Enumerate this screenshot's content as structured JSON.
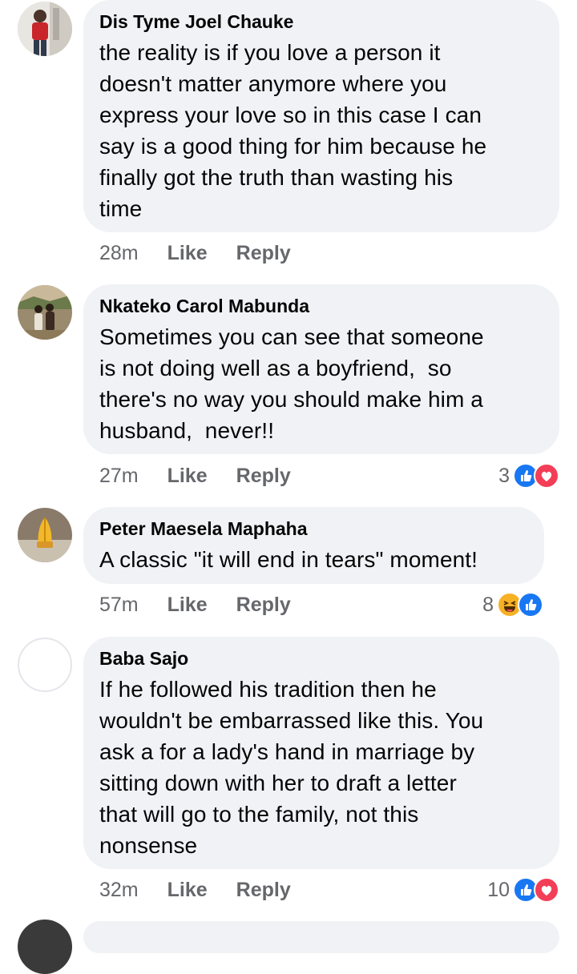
{
  "comments": [
    {
      "author": "Dis Tyme Joel Chauke",
      "text": "the reality is if you love a person it\ndoesn't matter anymore where you\nexpress your love so in this case I can\nsay is a good thing for him because he\nfinally got the truth than wasting his\ntime",
      "time": "28m",
      "like": "Like",
      "reply": "Reply",
      "reaction_count": "",
      "reactions": [],
      "avatar": "photo"
    },
    {
      "author": "Nkateko Carol Mabunda",
      "text": "Sometimes you can see that someone\nis not doing well as a boyfriend,  so\nthere's no way you should make him a\nhusband,  never!!",
      "time": "27m",
      "like": "Like",
      "reply": "Reply",
      "reaction_count": "3",
      "reactions": [
        "like-icon",
        "love-icon"
      ],
      "avatar": "photo"
    },
    {
      "author": "Peter Maesela Maphaha",
      "text": "A classic \"it will end in tears\" moment!",
      "time": "57m",
      "like": "Like",
      "reply": "Reply",
      "reaction_count": "8",
      "reactions": [
        "haha-icon",
        "like-icon"
      ],
      "avatar": "praying-hands"
    },
    {
      "author": "Baba Sajo",
      "text": "If he followed his tradition then he\nwouldn't be embarrassed like this. You\nask a for a lady's hand in marriage by\nsitting down with her to draft a letter\nthat will go to the family, not this\nnonsense",
      "time": "32m",
      "like": "Like",
      "reply": "Reply",
      "reaction_count": "10",
      "reactions": [
        "like-icon",
        "love-icon"
      ],
      "avatar": "blank"
    }
  ],
  "colors": {
    "bubble": "#f0f2f5",
    "meta": "#65676b",
    "like": "#1877f2",
    "love": "#f33e58",
    "haha": "#f7b125"
  }
}
